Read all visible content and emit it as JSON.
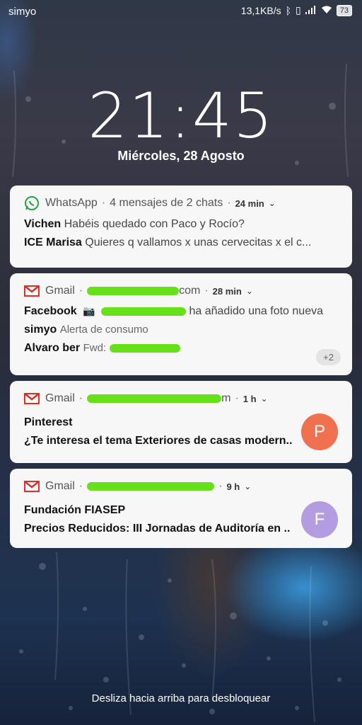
{
  "status_bar": {
    "carrier": "simyo",
    "speed": "13,1KB/s",
    "battery": "73"
  },
  "lockscreen": {
    "time": "21:45",
    "date": "Miércoles, 28 Agosto",
    "unlock_hint": "Desliza hacia arriba para desbloquear"
  },
  "notifications": [
    {
      "app": "WhatsApp",
      "summary": "4 mensajes de 2 chats",
      "time": "24 min",
      "rows": [
        {
          "sender": "Vichen",
          "text": "Habéis quedado con Paco y Rocío?"
        },
        {
          "sender": "ICE Marisa",
          "text": "Quieres q vallamos x unas cervecitas x el c..."
        }
      ]
    },
    {
      "app": "Gmail",
      "account_visible": "com",
      "time": "28 min",
      "rows": [
        {
          "sender": "Facebook",
          "text": "ha añadido una foto nueva"
        },
        {
          "sender": "simyo",
          "text": "Alerta de consumo"
        },
        {
          "sender": "Alvaro ber",
          "text": "Fwd:"
        }
      ],
      "badge": "+2"
    },
    {
      "app": "Gmail",
      "account_visible": "m",
      "time": "1 h",
      "title": "Pinterest",
      "text": "¿Te interesa el tema Exteriores de casas modern..",
      "avatar_letter": "P",
      "avatar_color": "#f0714f"
    },
    {
      "app": "Gmail",
      "time": "9 h",
      "title": "Fundación FIASEP",
      "text": "Precios Reducidos:  III Jornadas de Auditoría en ..",
      "avatar_letter": "F",
      "avatar_color": "#b39ce0"
    }
  ],
  "colors": {
    "whatsapp": "#25a244",
    "gmail": "#d93025",
    "redaction": "#66e018"
  }
}
